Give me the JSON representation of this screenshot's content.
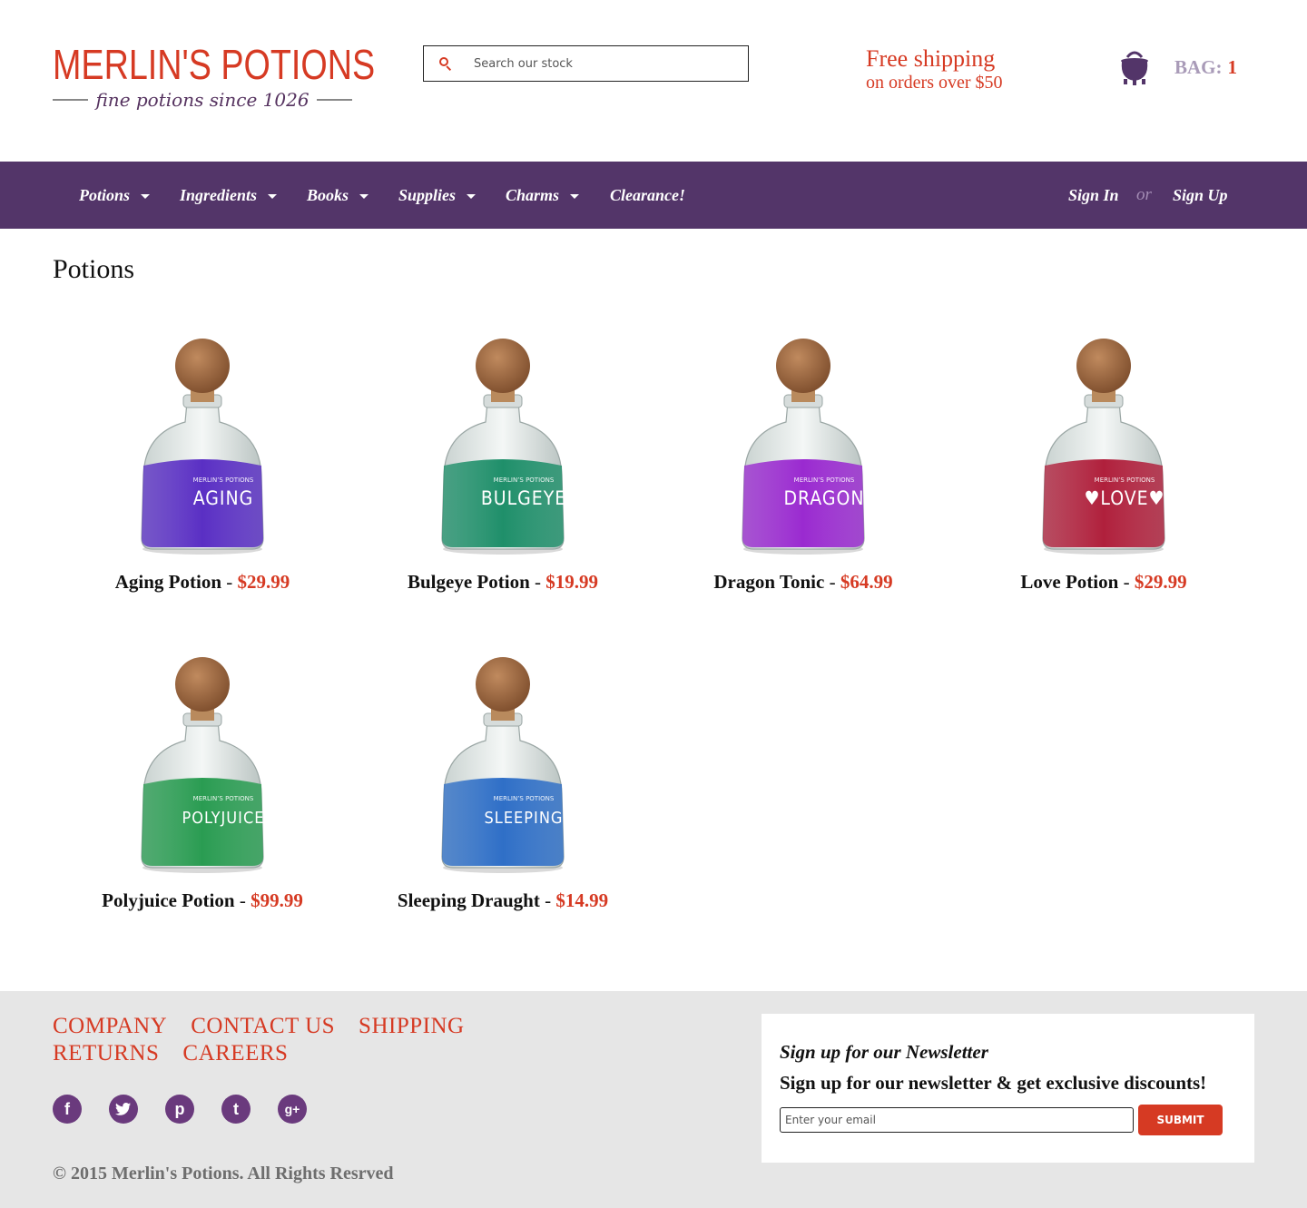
{
  "brand": {
    "name": "MERLIN'S POTIONS",
    "tagline": "fine potions since 1026",
    "accent": "#d63a23",
    "purple": "#533569"
  },
  "search": {
    "placeholder": "Search our stock",
    "value": ""
  },
  "shipping": {
    "line1": "Free shipping",
    "line2": "on orders over $50"
  },
  "bag": {
    "label": "BAG:",
    "count": "1",
    "icon": "cauldron-icon"
  },
  "nav": {
    "items": [
      {
        "label": "Potions",
        "dropdown": true
      },
      {
        "label": "Ingredients",
        "dropdown": true
      },
      {
        "label": "Books",
        "dropdown": true
      },
      {
        "label": "Supplies",
        "dropdown": true
      },
      {
        "label": "Charms",
        "dropdown": true
      },
      {
        "label": "Clearance!",
        "dropdown": false
      }
    ],
    "sign_in": "Sign In",
    "or": "or",
    "sign_up": "Sign Up"
  },
  "page": {
    "title": "Potions"
  },
  "products": [
    {
      "name": "Aging Potion",
      "separator": "-",
      "price": "$29.99",
      "label_text": "AGING",
      "liquid_color": "#5a2fc4"
    },
    {
      "name": "Bulgeye Potion",
      "separator": "-",
      "price": "$19.99",
      "label_text": "BULGEYE",
      "liquid_color": "#1f8f6a"
    },
    {
      "name": "Dragon Tonic",
      "separator": "-",
      "price": "$64.99",
      "label_text": "DRAGON",
      "liquid_color": "#9a2ad0"
    },
    {
      "name": "Love Potion",
      "separator": "-",
      "price": "$29.99",
      "label_text": "♥LOVE♥",
      "liquid_color": "#b0203c"
    },
    {
      "name": "Polyjuice Potion",
      "separator": "-",
      "price": "$99.99",
      "label_text": "POLYJUICE",
      "liquid_color": "#2a9c52"
    },
    {
      "name": "Sleeping Draught",
      "separator": "-",
      "price": "$14.99",
      "label_text": "SLEEPING",
      "liquid_color": "#2f6fc7"
    }
  ],
  "footer": {
    "links_row1": [
      "COMPANY",
      "CONTACT US",
      "SHIPPING"
    ],
    "links_row2": [
      "RETURNS",
      "CAREERS"
    ],
    "social": [
      "facebook-icon",
      "twitter-icon",
      "pinterest-icon",
      "tumblr-icon",
      "google-plus-icon"
    ],
    "copyright": "© 2015 Merlin's Potions. All Rights Resrved"
  },
  "newsletter": {
    "title": "Sign up for our Newsletter",
    "subtitle": "Sign up for our newsletter & get exclusive discounts!",
    "placeholder": "Enter your email",
    "button": "SUBMIT"
  }
}
